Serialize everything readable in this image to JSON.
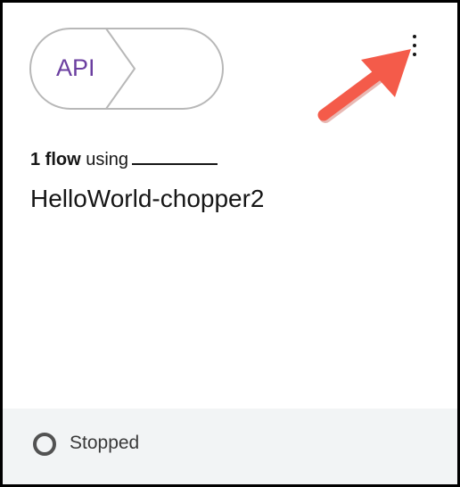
{
  "card": {
    "tag_label": "API",
    "flow_count": "1 flow",
    "flow_using": "using",
    "app_name": "HelloWorld-chopper2",
    "status": "Stopped"
  },
  "icons": {
    "menu": "overflow-menu-vertical-icon",
    "arrow": "callout-arrow-icon",
    "status": "stopped-status-icon"
  },
  "colors": {
    "tag_text": "#6b3fa0",
    "tag_border": "#b8b8b8",
    "arrow": "#f45b4a",
    "footer_bg": "#f2f4f5",
    "status_icon": "#525252"
  }
}
